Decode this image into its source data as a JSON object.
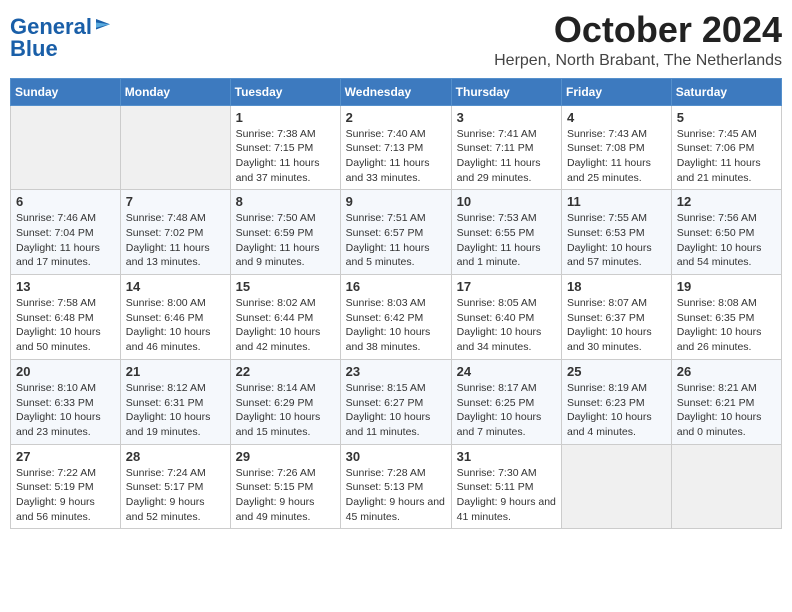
{
  "header": {
    "logo_general": "General",
    "logo_blue": "Blue",
    "month_title": "October 2024",
    "location": "Herpen, North Brabant, The Netherlands"
  },
  "days_of_week": [
    "Sunday",
    "Monday",
    "Tuesday",
    "Wednesday",
    "Thursday",
    "Friday",
    "Saturday"
  ],
  "weeks": [
    [
      {
        "day": "",
        "sunrise": "",
        "sunset": "",
        "daylight": ""
      },
      {
        "day": "",
        "sunrise": "",
        "sunset": "",
        "daylight": ""
      },
      {
        "day": "1",
        "sunrise": "Sunrise: 7:38 AM",
        "sunset": "Sunset: 7:15 PM",
        "daylight": "Daylight: 11 hours and 37 minutes."
      },
      {
        "day": "2",
        "sunrise": "Sunrise: 7:40 AM",
        "sunset": "Sunset: 7:13 PM",
        "daylight": "Daylight: 11 hours and 33 minutes."
      },
      {
        "day": "3",
        "sunrise": "Sunrise: 7:41 AM",
        "sunset": "Sunset: 7:11 PM",
        "daylight": "Daylight: 11 hours and 29 minutes."
      },
      {
        "day": "4",
        "sunrise": "Sunrise: 7:43 AM",
        "sunset": "Sunset: 7:08 PM",
        "daylight": "Daylight: 11 hours and 25 minutes."
      },
      {
        "day": "5",
        "sunrise": "Sunrise: 7:45 AM",
        "sunset": "Sunset: 7:06 PM",
        "daylight": "Daylight: 11 hours and 21 minutes."
      }
    ],
    [
      {
        "day": "6",
        "sunrise": "Sunrise: 7:46 AM",
        "sunset": "Sunset: 7:04 PM",
        "daylight": "Daylight: 11 hours and 17 minutes."
      },
      {
        "day": "7",
        "sunrise": "Sunrise: 7:48 AM",
        "sunset": "Sunset: 7:02 PM",
        "daylight": "Daylight: 11 hours and 13 minutes."
      },
      {
        "day": "8",
        "sunrise": "Sunrise: 7:50 AM",
        "sunset": "Sunset: 6:59 PM",
        "daylight": "Daylight: 11 hours and 9 minutes."
      },
      {
        "day": "9",
        "sunrise": "Sunrise: 7:51 AM",
        "sunset": "Sunset: 6:57 PM",
        "daylight": "Daylight: 11 hours and 5 minutes."
      },
      {
        "day": "10",
        "sunrise": "Sunrise: 7:53 AM",
        "sunset": "Sunset: 6:55 PM",
        "daylight": "Daylight: 11 hours and 1 minute."
      },
      {
        "day": "11",
        "sunrise": "Sunrise: 7:55 AM",
        "sunset": "Sunset: 6:53 PM",
        "daylight": "Daylight: 10 hours and 57 minutes."
      },
      {
        "day": "12",
        "sunrise": "Sunrise: 7:56 AM",
        "sunset": "Sunset: 6:50 PM",
        "daylight": "Daylight: 10 hours and 54 minutes."
      }
    ],
    [
      {
        "day": "13",
        "sunrise": "Sunrise: 7:58 AM",
        "sunset": "Sunset: 6:48 PM",
        "daylight": "Daylight: 10 hours and 50 minutes."
      },
      {
        "day": "14",
        "sunrise": "Sunrise: 8:00 AM",
        "sunset": "Sunset: 6:46 PM",
        "daylight": "Daylight: 10 hours and 46 minutes."
      },
      {
        "day": "15",
        "sunrise": "Sunrise: 8:02 AM",
        "sunset": "Sunset: 6:44 PM",
        "daylight": "Daylight: 10 hours and 42 minutes."
      },
      {
        "day": "16",
        "sunrise": "Sunrise: 8:03 AM",
        "sunset": "Sunset: 6:42 PM",
        "daylight": "Daylight: 10 hours and 38 minutes."
      },
      {
        "day": "17",
        "sunrise": "Sunrise: 8:05 AM",
        "sunset": "Sunset: 6:40 PM",
        "daylight": "Daylight: 10 hours and 34 minutes."
      },
      {
        "day": "18",
        "sunrise": "Sunrise: 8:07 AM",
        "sunset": "Sunset: 6:37 PM",
        "daylight": "Daylight: 10 hours and 30 minutes."
      },
      {
        "day": "19",
        "sunrise": "Sunrise: 8:08 AM",
        "sunset": "Sunset: 6:35 PM",
        "daylight": "Daylight: 10 hours and 26 minutes."
      }
    ],
    [
      {
        "day": "20",
        "sunrise": "Sunrise: 8:10 AM",
        "sunset": "Sunset: 6:33 PM",
        "daylight": "Daylight: 10 hours and 23 minutes."
      },
      {
        "day": "21",
        "sunrise": "Sunrise: 8:12 AM",
        "sunset": "Sunset: 6:31 PM",
        "daylight": "Daylight: 10 hours and 19 minutes."
      },
      {
        "day": "22",
        "sunrise": "Sunrise: 8:14 AM",
        "sunset": "Sunset: 6:29 PM",
        "daylight": "Daylight: 10 hours and 15 minutes."
      },
      {
        "day": "23",
        "sunrise": "Sunrise: 8:15 AM",
        "sunset": "Sunset: 6:27 PM",
        "daylight": "Daylight: 10 hours and 11 minutes."
      },
      {
        "day": "24",
        "sunrise": "Sunrise: 8:17 AM",
        "sunset": "Sunset: 6:25 PM",
        "daylight": "Daylight: 10 hours and 7 minutes."
      },
      {
        "day": "25",
        "sunrise": "Sunrise: 8:19 AM",
        "sunset": "Sunset: 6:23 PM",
        "daylight": "Daylight: 10 hours and 4 minutes."
      },
      {
        "day": "26",
        "sunrise": "Sunrise: 8:21 AM",
        "sunset": "Sunset: 6:21 PM",
        "daylight": "Daylight: 10 hours and 0 minutes."
      }
    ],
    [
      {
        "day": "27",
        "sunrise": "Sunrise: 7:22 AM",
        "sunset": "Sunset: 5:19 PM",
        "daylight": "Daylight: 9 hours and 56 minutes."
      },
      {
        "day": "28",
        "sunrise": "Sunrise: 7:24 AM",
        "sunset": "Sunset: 5:17 PM",
        "daylight": "Daylight: 9 hours and 52 minutes."
      },
      {
        "day": "29",
        "sunrise": "Sunrise: 7:26 AM",
        "sunset": "Sunset: 5:15 PM",
        "daylight": "Daylight: 9 hours and 49 minutes."
      },
      {
        "day": "30",
        "sunrise": "Sunrise: 7:28 AM",
        "sunset": "Sunset: 5:13 PM",
        "daylight": "Daylight: 9 hours and 45 minutes."
      },
      {
        "day": "31",
        "sunrise": "Sunrise: 7:30 AM",
        "sunset": "Sunset: 5:11 PM",
        "daylight": "Daylight: 9 hours and 41 minutes."
      },
      {
        "day": "",
        "sunrise": "",
        "sunset": "",
        "daylight": ""
      },
      {
        "day": "",
        "sunrise": "",
        "sunset": "",
        "daylight": ""
      }
    ]
  ]
}
